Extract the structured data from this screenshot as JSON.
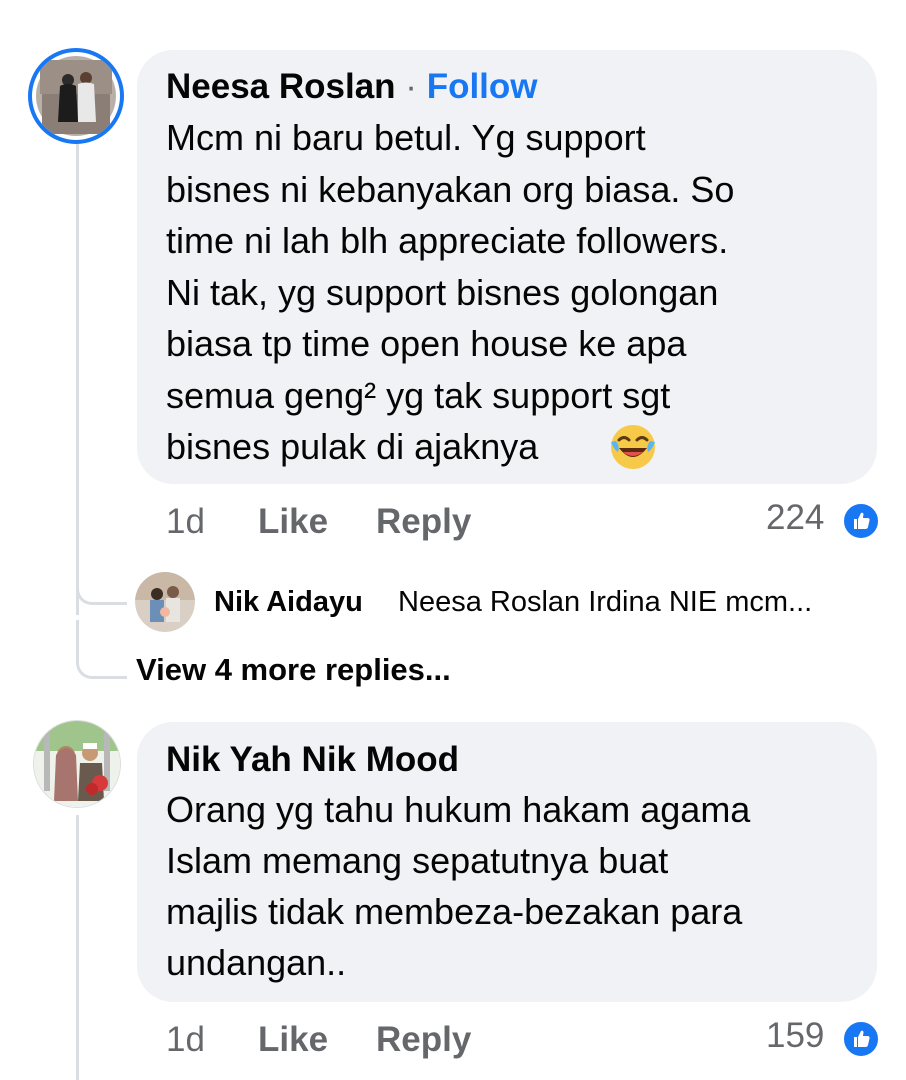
{
  "comments": [
    {
      "author": "Neesa Roslan",
      "follow_label": "Follow",
      "separator": "·",
      "lines": [
        "Mcm ni baru betul. Yg support",
        "bisnes ni kebanyakan org biasa. So",
        "time ni lah blh appreciate followers.",
        "Ni tak, yg support bisnes golongan",
        "biasa tp time open house ke apa",
        "semua geng² yg tak support sgt",
        "bisnes pulak di ajaknya"
      ],
      "emoji": "laughing-tears-emoji",
      "time": "1d",
      "like_label": "Like",
      "reply_label": "Reply",
      "reaction_count": "224",
      "reaction_icon": "like-reaction-icon"
    },
    {
      "author": "Nik Yah Nik Mood",
      "lines": [
        "Orang yg tahu hukum hakam agama",
        "Islam memang sepatutnya buat",
        "majlis tidak membeza-bezakan para",
        "undangan.."
      ],
      "time": "1d",
      "like_label": "Like",
      "reply_label": "Reply",
      "reaction_count": "159",
      "reaction_icon": "like-reaction-icon"
    }
  ],
  "reply_preview": {
    "author": "Nik Aidayu",
    "text": "Neesa Roslan Irdina NIE mcm..."
  },
  "view_more_label": "View 4 more replies...",
  "colors": {
    "accent": "#1877f2",
    "bubble": "#f0f2f5",
    "muted": "#65676b",
    "thread": "#dadde1"
  }
}
